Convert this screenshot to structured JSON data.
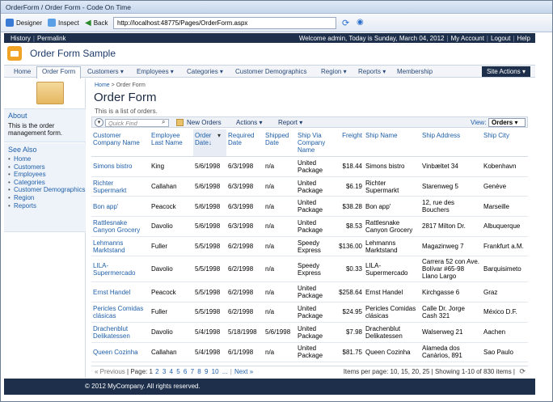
{
  "window": {
    "title": "OrderForm / Order Form - Code On Time"
  },
  "toolbar": {
    "designer": "Designer",
    "inspect": "Inspect",
    "back": "Back",
    "url": "http://localhost:48775/Pages/OrderForm.aspx"
  },
  "topbar": {
    "history": "History",
    "permalink": "Permalink",
    "welcome": "Welcome admin, Today is Sunday, March 04, 2012",
    "my_account": "My Account",
    "logout": "Logout",
    "help": "Help"
  },
  "app": {
    "title": "Order Form Sample"
  },
  "menu": {
    "items": [
      "Home",
      "Order Form",
      "Customers ▾",
      "Employees ▾",
      "Categories ▾",
      "Customer Demographics",
      "Region ▾",
      "Reports ▾",
      "Membership"
    ],
    "site_actions": "Site Actions ▾"
  },
  "sidebar": {
    "about_title": "About",
    "about_text": "This is the order management form.",
    "see_also_title": "See Also",
    "links": [
      "Home",
      "Customers",
      "Employees",
      "Categories",
      "Customer Demographics",
      "Region",
      "Reports"
    ]
  },
  "main": {
    "breadcrumb_home": "Home",
    "breadcrumb_sep": ">",
    "breadcrumb_current": "Order Form",
    "title": "Order Form",
    "description": "This is a list of orders."
  },
  "gridbar": {
    "quick_find": "Quick Find",
    "new_orders": "New Orders",
    "actions": "Actions ▾",
    "report": "Report ▾",
    "view_label": "View:",
    "view_value": "Orders ▾"
  },
  "grid": {
    "headers": [
      "Customer Company Name",
      "Employee Last Name",
      "Order Date↓",
      "",
      "Required Date",
      "Shipped Date",
      "Ship Via Company Name",
      "Freight",
      "Ship Name",
      "Ship Address",
      "Ship City"
    ],
    "rows": [
      [
        "Simons bistro",
        "King",
        "5/6/1998",
        "6/3/1998",
        "n/a",
        "United Package",
        "$18.44",
        "Simons bistro",
        "Vinbæltet 34",
        "Kobenhavn"
      ],
      [
        "Richter Supermarkt",
        "Callahan",
        "5/6/1998",
        "6/3/1998",
        "n/a",
        "United Package",
        "$6.19",
        "Richter Supermarkt",
        "Starenweg 5",
        "Genève"
      ],
      [
        "Bon app'",
        "Peacock",
        "5/6/1998",
        "6/3/1998",
        "n/a",
        "United Package",
        "$38.28",
        "Bon app'",
        "12, rue des Bouchers",
        "Marseille"
      ],
      [
        "Rattlesnake Canyon Grocery",
        "Davolio",
        "5/6/1998",
        "6/3/1998",
        "n/a",
        "United Package",
        "$8.53",
        "Rattlesnake Canyon Grocery",
        "2817 Milton Dr.",
        "Albuquerque"
      ],
      [
        "Lehmanns Marktstand",
        "Fuller",
        "5/5/1998",
        "6/2/1998",
        "n/a",
        "Speedy Express",
        "$136.00",
        "Lehmanns Marktstand",
        "Magazinweg 7",
        "Frankfurt a.M."
      ],
      [
        "LILA-Supermercado",
        "Davolio",
        "5/5/1998",
        "6/2/1998",
        "n/a",
        "Speedy Express",
        "$0.33",
        "LILA-Supermercado",
        "Carrera 52 con Ave. Bolívar #65-98 Llano Largo",
        "Barquisimeto"
      ],
      [
        "Ernst Handel",
        "Peacock",
        "5/5/1998",
        "6/2/1998",
        "n/a",
        "United Package",
        "$258.64",
        "Ernst Handel",
        "Kirchgasse 6",
        "Graz"
      ],
      [
        "Pericles Comidas clásicas",
        "Fuller",
        "5/5/1998",
        "6/2/1998",
        "n/a",
        "United Package",
        "$24.95",
        "Pericles Comidas clásicas",
        "Calle Dr. Jorge Cash 321",
        "México D.F."
      ],
      [
        "Drachenblut Delikatessen",
        "Davolio",
        "5/4/1998",
        "5/18/1998",
        "5/6/1998",
        "United Package",
        "$7.98",
        "Drachenblut Delikatessen",
        "Walserweg 21",
        "Aachen"
      ],
      [
        "Queen Cozinha",
        "Callahan",
        "5/4/1998",
        "6/1/1998",
        "n/a",
        "United Package",
        "$81.75",
        "Queen Cozinha",
        "Alameda dos Canàrios, 891",
        "Sao Paulo"
      ]
    ]
  },
  "pager": {
    "prev": "« Previous",
    "page_label": "| Page:",
    "pages": [
      "1",
      "2",
      "3",
      "4",
      "5",
      "6",
      "7",
      "8",
      "9",
      "10",
      "..."
    ],
    "next": "Next »",
    "items_per_page": "Items per page: 10, 15, 20, 25 | Showing 1-10 of 830 items |"
  },
  "footer": {
    "copyright": "© 2012 MyCompany. All rights reserved."
  },
  "colors": {
    "navy": "#1d2f4a",
    "link": "#1f5fa8",
    "logo": "#f0a325"
  }
}
